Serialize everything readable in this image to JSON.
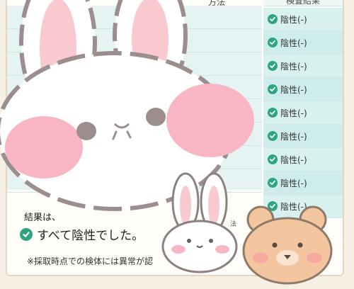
{
  "table": {
    "method_header": "方法",
    "result_header": "検査結果",
    "rows": [
      "陰性(-)",
      "陰性(-)",
      "陰性(-)",
      "陰性(-)",
      "陰性(-)",
      "陰性(-)",
      "陰性(-)",
      "陰性(-)",
      "陰性(-)"
    ]
  },
  "summary": {
    "label": "結果は、",
    "main": "すべて陰性でした。",
    "method_small": "法",
    "partial": "い"
  },
  "footnote": "※採取時点での検体には異常が認",
  "colors": {
    "check": "#2ea57f",
    "row_bg": "#d8f1ef",
    "bunny_cheek": "#f7b6c1",
    "bear": "#f3c6a0"
  },
  "icons": [
    "check-circle-icon",
    "bunny-sticker",
    "small-bunny-sticker",
    "bear-sticker"
  ]
}
